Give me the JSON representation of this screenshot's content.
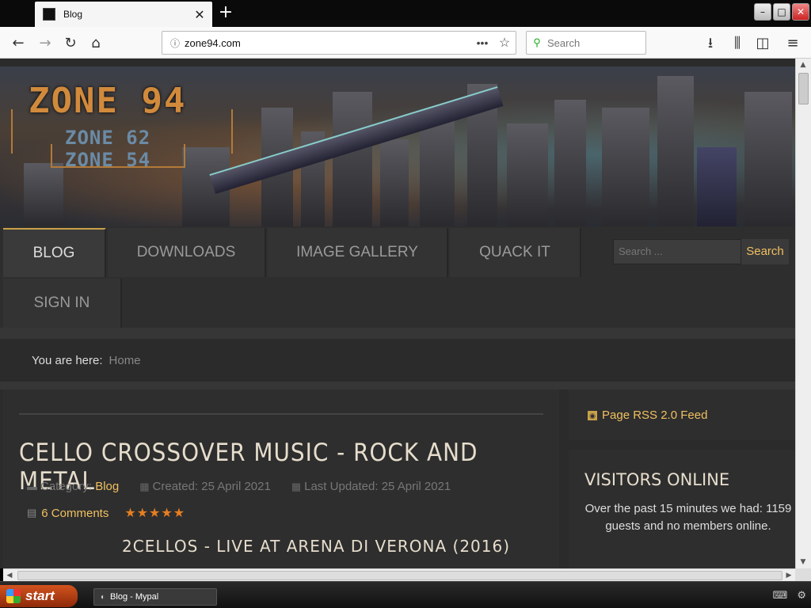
{
  "browser": {
    "tab_title": "Blog",
    "url": "zone94.com",
    "search_placeholder": "Search",
    "new_tab": "+",
    "tab_close": "✕"
  },
  "site": {
    "logo_main": "ZONE 94",
    "logo_sub1": "ZONE 62",
    "logo_sub2": "ZONE 54",
    "menu": [
      {
        "label": "BLOG"
      },
      {
        "label": "DOWNLOADS"
      },
      {
        "label": "IMAGE GALLERY"
      },
      {
        "label": "QUACK IT"
      },
      {
        "label": "SIGN IN"
      }
    ],
    "search_placeholder": "Search ...",
    "search_button": "Search",
    "breadcrumb_label": "You are here:",
    "breadcrumb_home": "Home"
  },
  "article": {
    "title": "CELLO CROSSOVER MUSIC - ROCK AND METAL",
    "category_label": "Category:",
    "category": "Blog",
    "created": "Created: 25 April 2021",
    "updated": "Last Updated: 25 April 2021",
    "comments": "6 Comments",
    "rating": 5,
    "subtitle": "2CELLOS - LIVE AT ARENA DI VERONA (2016)"
  },
  "sidebar": {
    "rss": "Page RSS 2.0 Feed",
    "visitors_title": "VISITORS ONLINE",
    "visitors_text": "Over the past 15 minutes we had: 1159 guests and no members online."
  },
  "taskbar": {
    "start": "start",
    "task": "Blog - Mypal"
  }
}
